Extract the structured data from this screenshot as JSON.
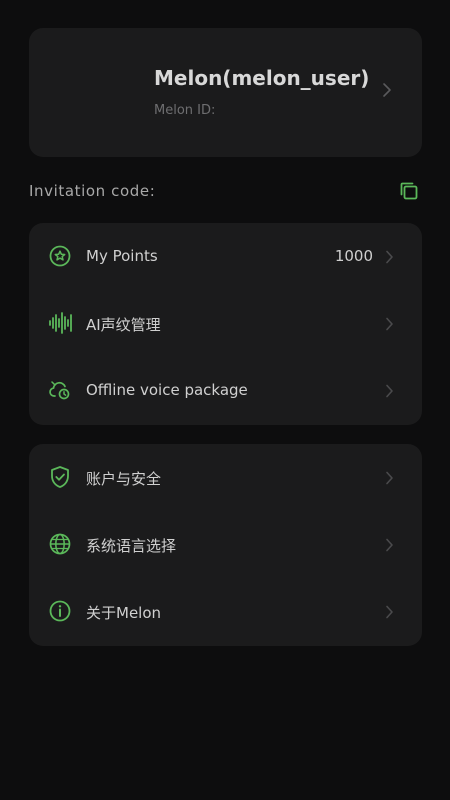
{
  "profile": {
    "name": "Melon(melon_user)",
    "id_label": "Melon ID:"
  },
  "invitation": {
    "label": "Invitation code:"
  },
  "menu_group_1": {
    "items": [
      {
        "label": "My Points",
        "value": "1000",
        "icon": "star-circle-icon"
      },
      {
        "label": "AI声纹管理",
        "icon": "voiceprint-icon"
      },
      {
        "label": "Offline voice package",
        "icon": "cloud-offline-icon"
      }
    ]
  },
  "menu_group_2": {
    "items": [
      {
        "label": "账户与安全",
        "icon": "shield-check-icon"
      },
      {
        "label": "系统语言选择",
        "icon": "globe-icon"
      },
      {
        "label": "关于Melon",
        "icon": "info-icon"
      }
    ]
  },
  "colors": {
    "background": "#0d0d0e",
    "card": "#1b1b1c",
    "accent": "#5bb85a",
    "text": "#d0d0d0",
    "muted": "#6e6e70"
  }
}
